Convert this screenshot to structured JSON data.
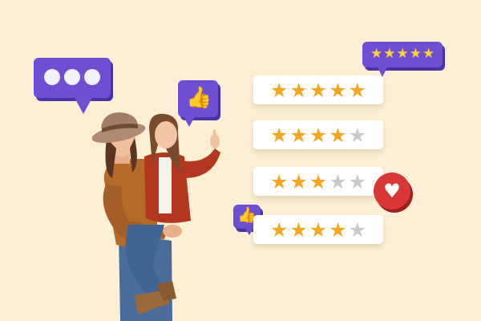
{
  "colors": {
    "background": "#fcefd6",
    "star_filled": "#f5a623",
    "star_empty": "#c9c9c9",
    "bubble_purple": "#6e4fd4",
    "heart_red": "#d93636"
  },
  "rating_cards": [
    {
      "rating": 5,
      "max": 5
    },
    {
      "rating": 4,
      "max": 5
    },
    {
      "rating": 3,
      "max": 5
    },
    {
      "rating": 4,
      "max": 5
    }
  ],
  "top_badge": {
    "rating": 5,
    "max": 5
  },
  "icons": {
    "star": "★",
    "thumb": "👍",
    "heart": "♥",
    "typing_bubble": "typing-bubble-icon",
    "thumbs_up_bubble": "thumbs-up-bubble-icon",
    "heart_badge": "heart-icon"
  }
}
